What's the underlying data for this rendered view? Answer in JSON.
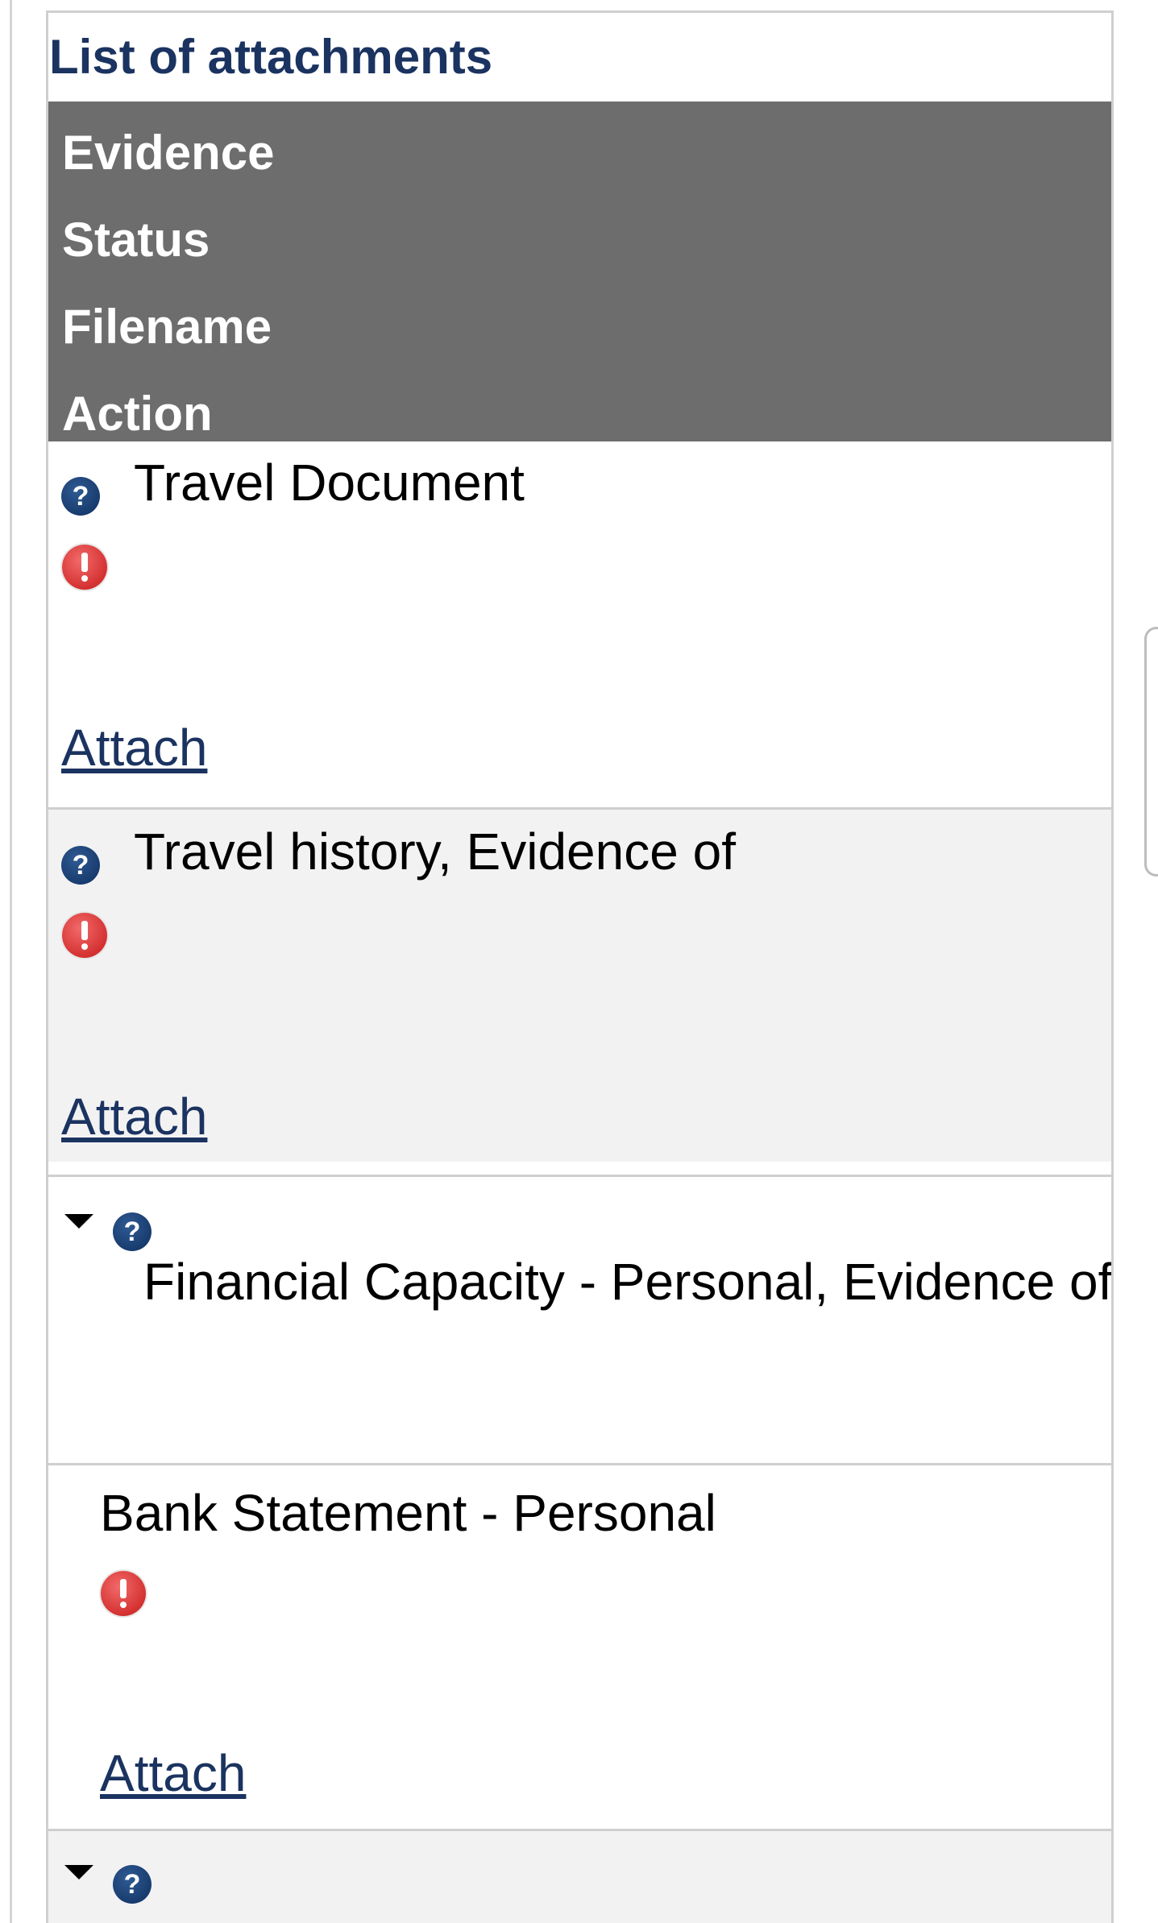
{
  "panel": {
    "title": "List of attachments"
  },
  "columns": [
    "Evidence",
    "Status",
    "Filename",
    "Action"
  ],
  "rows": [
    {
      "label": "Travel Document",
      "action": "Attach",
      "status_icon": "warning-icon",
      "help_icon": "help-icon"
    },
    {
      "label": "Travel history, Evidence of",
      "action": "Attach",
      "status_icon": "warning-icon",
      "help_icon": "help-icon"
    },
    {
      "label": "Financial Capacity - Personal, Evidence of",
      "expandable": true,
      "expanded": true,
      "help_icon": "help-icon"
    },
    {
      "label": "Bank Statement - Personal",
      "action": "Attach",
      "status_icon": "warning-icon",
      "sub_item": true
    }
  ],
  "help_glyph": "?",
  "colors": {
    "title": "#1b3360",
    "header_bg": "#6d6d6d",
    "link": "#1b3360",
    "warning": "#d62a2a",
    "help": "#0e2f5f",
    "alt_row": "#f2f2f2"
  }
}
